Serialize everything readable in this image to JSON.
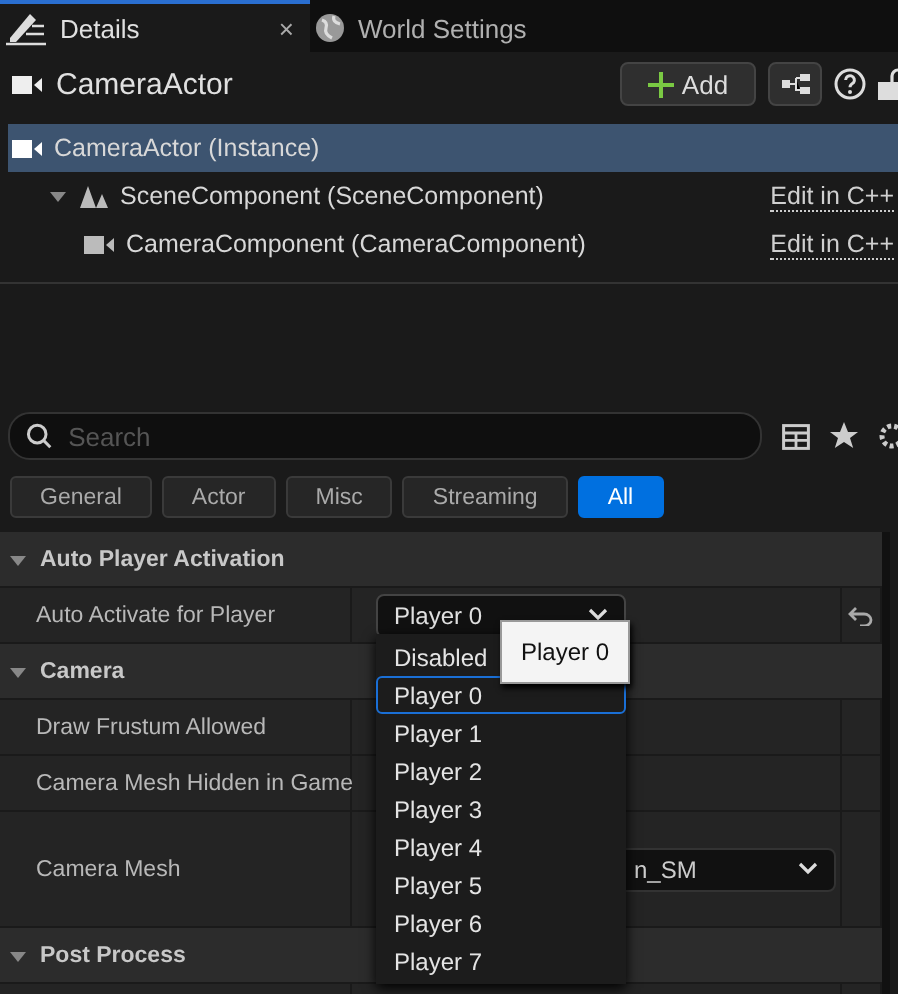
{
  "tabs": [
    {
      "label": "Details",
      "selected": true,
      "close": "×"
    },
    {
      "label": "World Settings",
      "selected": false
    }
  ],
  "header": {
    "title": "CameraActor",
    "add_button": "Add"
  },
  "tree": [
    {
      "label": "CameraActor (Instance)",
      "selected": true,
      "children": [
        {
          "label": "SceneComponent (SceneComponent)",
          "selected": false,
          "expanded": true,
          "link": "Edit in C++",
          "children": [
            {
              "label": "CameraComponent (CameraComponent)",
              "selected": false,
              "link": "Edit in C++"
            }
          ]
        }
      ]
    }
  ],
  "search": {
    "placeholder": "Search"
  },
  "filters": [
    {
      "label": "General",
      "selected": false
    },
    {
      "label": "Actor",
      "selected": false
    },
    {
      "label": "Misc",
      "selected": false
    },
    {
      "label": "Streaming",
      "selected": false
    },
    {
      "label": "All",
      "selected": true
    }
  ],
  "sections": [
    {
      "title": "Auto Player Activation",
      "expanded": true,
      "rows": [
        {
          "name": "Auto Activate for Player",
          "kind": "combo",
          "value": "Player 0",
          "reset": true
        }
      ]
    },
    {
      "title": "Camera",
      "expanded": true,
      "rows": [
        {
          "name": "Draw Frustum Allowed",
          "kind": "plain"
        },
        {
          "name": "Camera Mesh Hidden in Game",
          "kind": "plain"
        },
        {
          "name": "Camera Mesh",
          "kind": "asset",
          "value": "n_SM"
        }
      ]
    },
    {
      "title": "Post Process",
      "expanded": true,
      "rows": [
        {
          "kind": "plain"
        }
      ]
    }
  ],
  "menu": {
    "items": [
      {
        "label": "Disabled",
        "selected": false
      },
      {
        "label": "Player 0",
        "selected": true
      },
      {
        "label": "Player 1",
        "selected": false
      },
      {
        "label": "Player 2",
        "selected": false
      },
      {
        "label": "Player 3",
        "selected": false
      },
      {
        "label": "Player 4",
        "selected": false
      },
      {
        "label": "Player 5",
        "selected": false
      },
      {
        "label": "Player 6",
        "selected": false
      },
      {
        "label": "Player 7",
        "selected": false
      }
    ]
  },
  "tooltip": "Player 0"
}
